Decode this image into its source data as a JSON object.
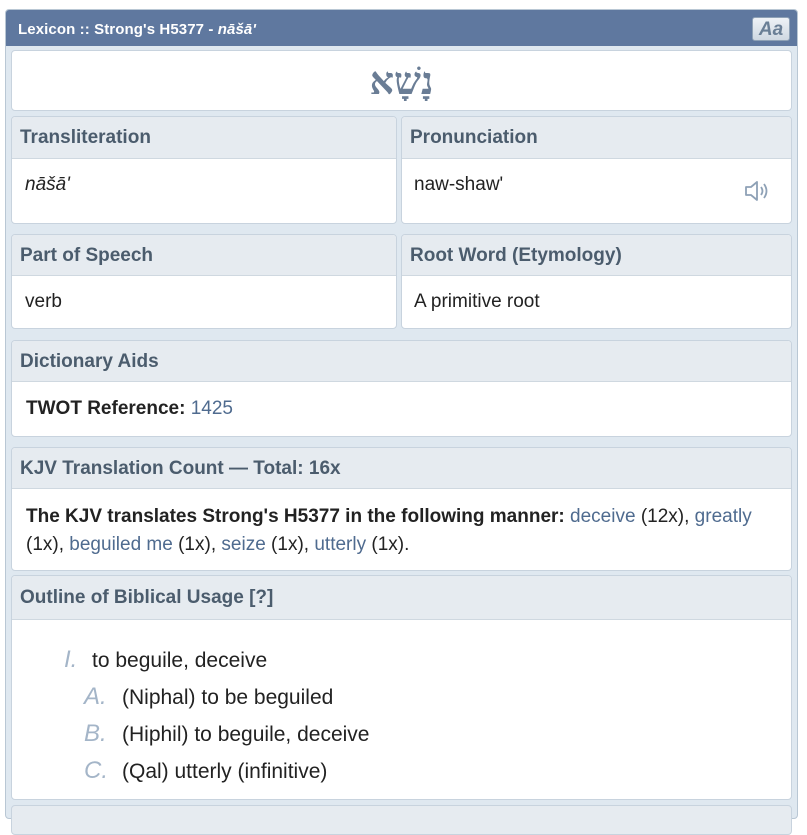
{
  "header": {
    "title_prefix": "Lexicon :: Strong's H5377 - ",
    "title_word": "nāšā'",
    "font_button_label": "Aa"
  },
  "lemma": {
    "hebrew": "נָשָׁא"
  },
  "transliteration": {
    "heading": "Transliteration",
    "value": "nāšā'"
  },
  "pronunciation": {
    "heading": "Pronunciation",
    "value": "naw-shaw'",
    "icon": "speaker-icon"
  },
  "part_of_speech": {
    "heading": "Part of Speech",
    "value": "verb"
  },
  "root_word": {
    "heading": "Root Word (Etymology)",
    "value": "A primitive root"
  },
  "dictionary_aids": {
    "heading": "Dictionary Aids",
    "twot_label": "TWOT Reference:",
    "twot_value": "1425"
  },
  "kjv": {
    "heading": "KJV Translation Count — Total: 16x",
    "intro": "The KJV translates Strong's H5377 in the following manner:",
    "items": [
      {
        "word": "deceive",
        "count": "(12x)",
        "sep": ", "
      },
      {
        "word": "greatly",
        "count": "(1x)",
        "sep": ", "
      },
      {
        "word": "beguiled me",
        "count": "(1x)",
        "sep": ", "
      },
      {
        "word": "seize",
        "count": "(1x)",
        "sep": ", "
      },
      {
        "word": "utterly",
        "count": "(1x)",
        "sep": "."
      }
    ]
  },
  "outline": {
    "heading": "Outline of Biblical Usage [?]",
    "items": [
      {
        "num": "I.",
        "text": "to beguile, deceive"
      },
      {
        "num": "A.",
        "text": "(Niphal) to be beguiled"
      },
      {
        "num": "B.",
        "text": "(Hiphil) to beguile, deceive"
      },
      {
        "num": "C.",
        "text": "(Qal) utterly (infinitive)"
      }
    ]
  }
}
